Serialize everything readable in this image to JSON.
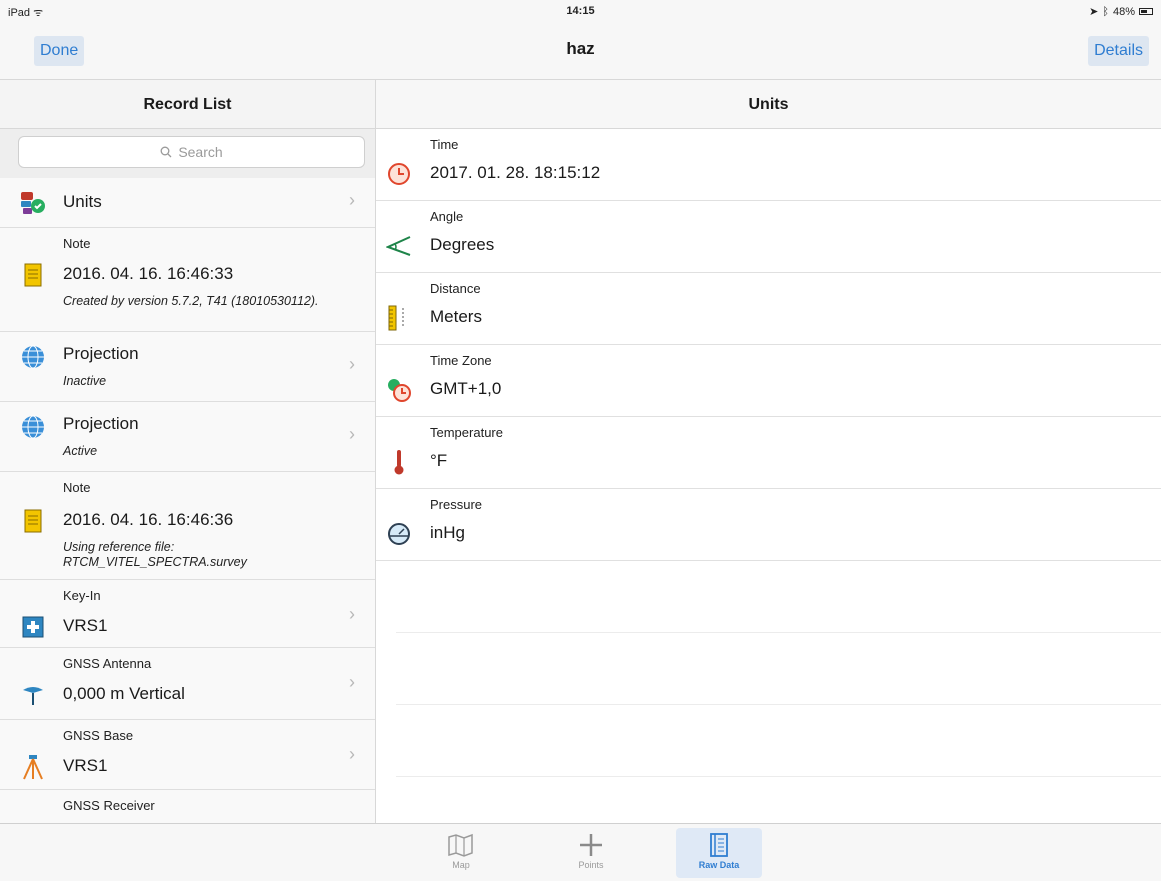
{
  "status": {
    "device": "iPad",
    "time": "14:15",
    "battery": "48%"
  },
  "nav": {
    "done": "Done",
    "title": "haz",
    "details": "Details"
  },
  "left": {
    "header": "Record List",
    "search_placeholder": "Search",
    "records": [
      {
        "caption": "",
        "main": "Units",
        "sub": "",
        "icon": "units-icon"
      },
      {
        "caption": "Note",
        "main": "2016. 04. 16. 16:46:33",
        "sub": "Created by version 5.7.2, T41 (18010530112).",
        "icon": "note-icon"
      },
      {
        "caption": "",
        "main": "Projection",
        "sub": "Inactive",
        "icon": "globe-icon"
      },
      {
        "caption": "",
        "main": "Projection",
        "sub": "Active",
        "icon": "globe-icon"
      },
      {
        "caption": "Note",
        "main": "2016. 04. 16. 16:46:36",
        "sub": "Using reference file: RTCM_VITEL_SPECTRA.survey",
        "icon": "note-icon"
      },
      {
        "caption": "Key-In",
        "main": "VRS1",
        "sub": "",
        "icon": "key-in-icon"
      },
      {
        "caption": "GNSS Antenna",
        "main": "0,000 m Vertical",
        "sub": "",
        "icon": "antenna-icon"
      },
      {
        "caption": "GNSS Base",
        "main": "VRS1",
        "sub": "",
        "icon": "base-tripod-icon"
      },
      {
        "caption": "GNSS Receiver",
        "main": "",
        "sub": "",
        "icon": ""
      }
    ]
  },
  "right": {
    "header": "Units",
    "rows": [
      {
        "label": "Time",
        "value": "2017. 01. 28. 18:15:12",
        "icon": "clock-icon"
      },
      {
        "label": "Angle",
        "value": "Degrees",
        "icon": "angle-icon"
      },
      {
        "label": "Distance",
        "value": "Meters",
        "icon": "ruler-icon"
      },
      {
        "label": "Time Zone",
        "value": "GMT+1,0",
        "icon": "timezone-icon"
      },
      {
        "label": "Temperature",
        "value": "°F",
        "icon": "thermometer-icon"
      },
      {
        "label": "Pressure",
        "value": "inHg",
        "icon": "gauge-icon"
      }
    ]
  },
  "tabs": {
    "map": "Map",
    "points": "Points",
    "raw": "Raw Data"
  },
  "colors": {
    "accent": "#2f7dd1",
    "note": "#f2c500",
    "globe": "#3a8fd8"
  }
}
